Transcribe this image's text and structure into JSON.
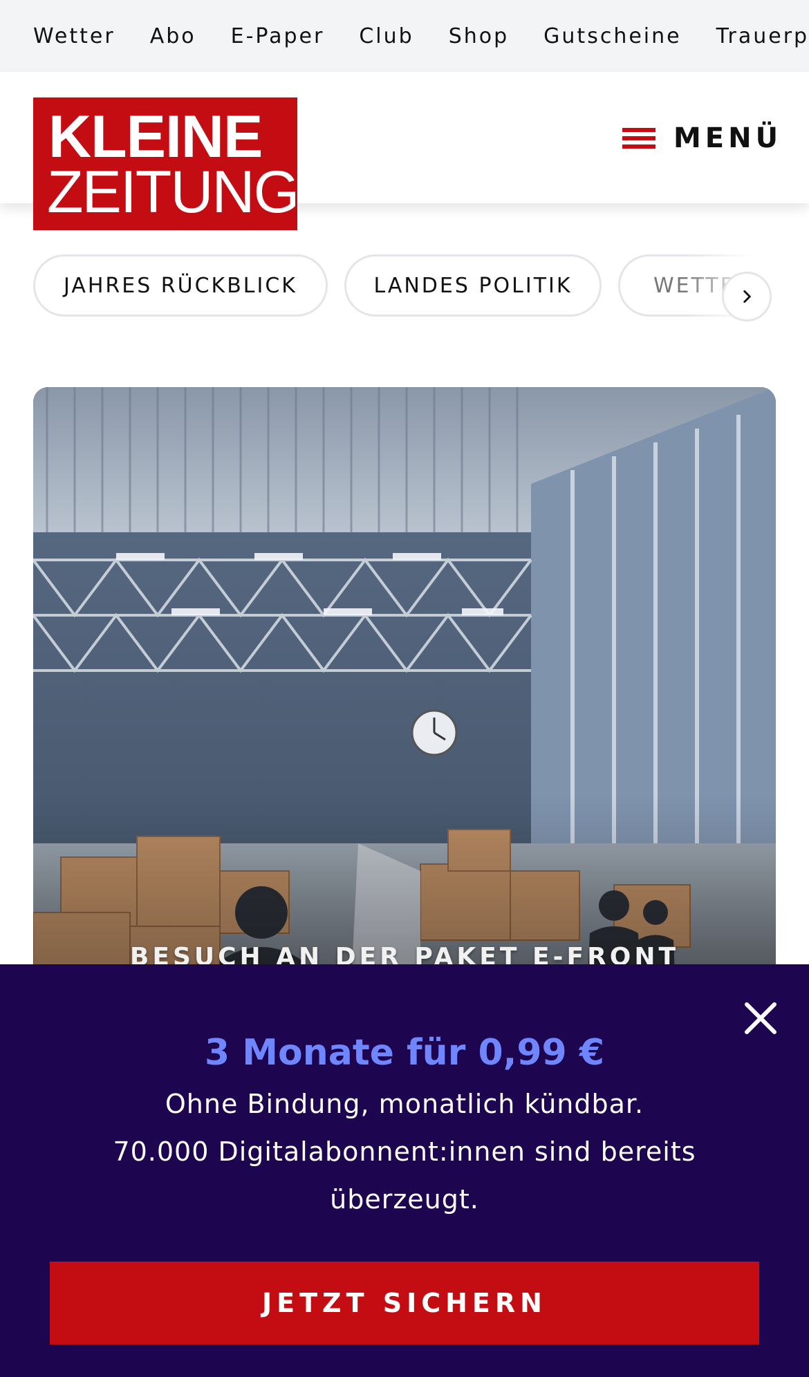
{
  "topnav": {
    "items": [
      "Wetter",
      "Abo",
      "E-Paper",
      "Club",
      "Shop",
      "Gutscheine",
      "Trauerportal"
    ]
  },
  "header": {
    "logo_line1": "KLEINE",
    "logo_line2": "ZEITUNG",
    "menu_label": "MENÜ"
  },
  "categories": {
    "items": [
      "JAHRES RÜCKBLICK",
      "LANDES POLITIK",
      "WETTER"
    ],
    "next_icon": "chevron-right-icon"
  },
  "hero": {
    "kicker": "BESUCH AN DER PAKET E-FRONT"
  },
  "promo": {
    "title": "3 Monate für 0,99 €",
    "line1": "Ohne Bindung, monatlich kündbar.",
    "line2": "70.000 Digitalabonnent:innen sind bereits",
    "line3": "überzeugt.",
    "cta_label": "JETZT SICHERN",
    "close_icon": "close-icon"
  },
  "colors": {
    "brand_red": "#c40d12",
    "promo_bg": "#1d0550",
    "promo_accent": "#6f86ff",
    "topnav_bg": "#f3f4f6"
  }
}
